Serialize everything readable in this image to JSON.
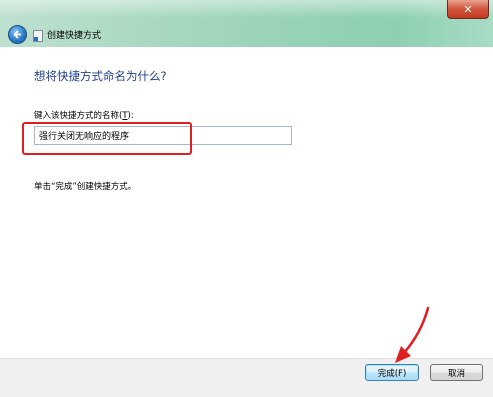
{
  "window": {
    "title": "创建快捷方式",
    "close_glyph": "✕"
  },
  "content": {
    "heading": "想将快捷方式命名为什么?",
    "field_label": "键入该快捷方式的名称(",
    "field_label_key": "T",
    "field_label_end": "):",
    "name_value": "强行关闭无响应的程序",
    "hint": "单击“完成”创建快捷方式。"
  },
  "buttons": {
    "finish": "完成(F)",
    "cancel": "取消"
  },
  "annotations": {
    "highlight_color": "#e02020",
    "arrow_color": "#e02020"
  }
}
